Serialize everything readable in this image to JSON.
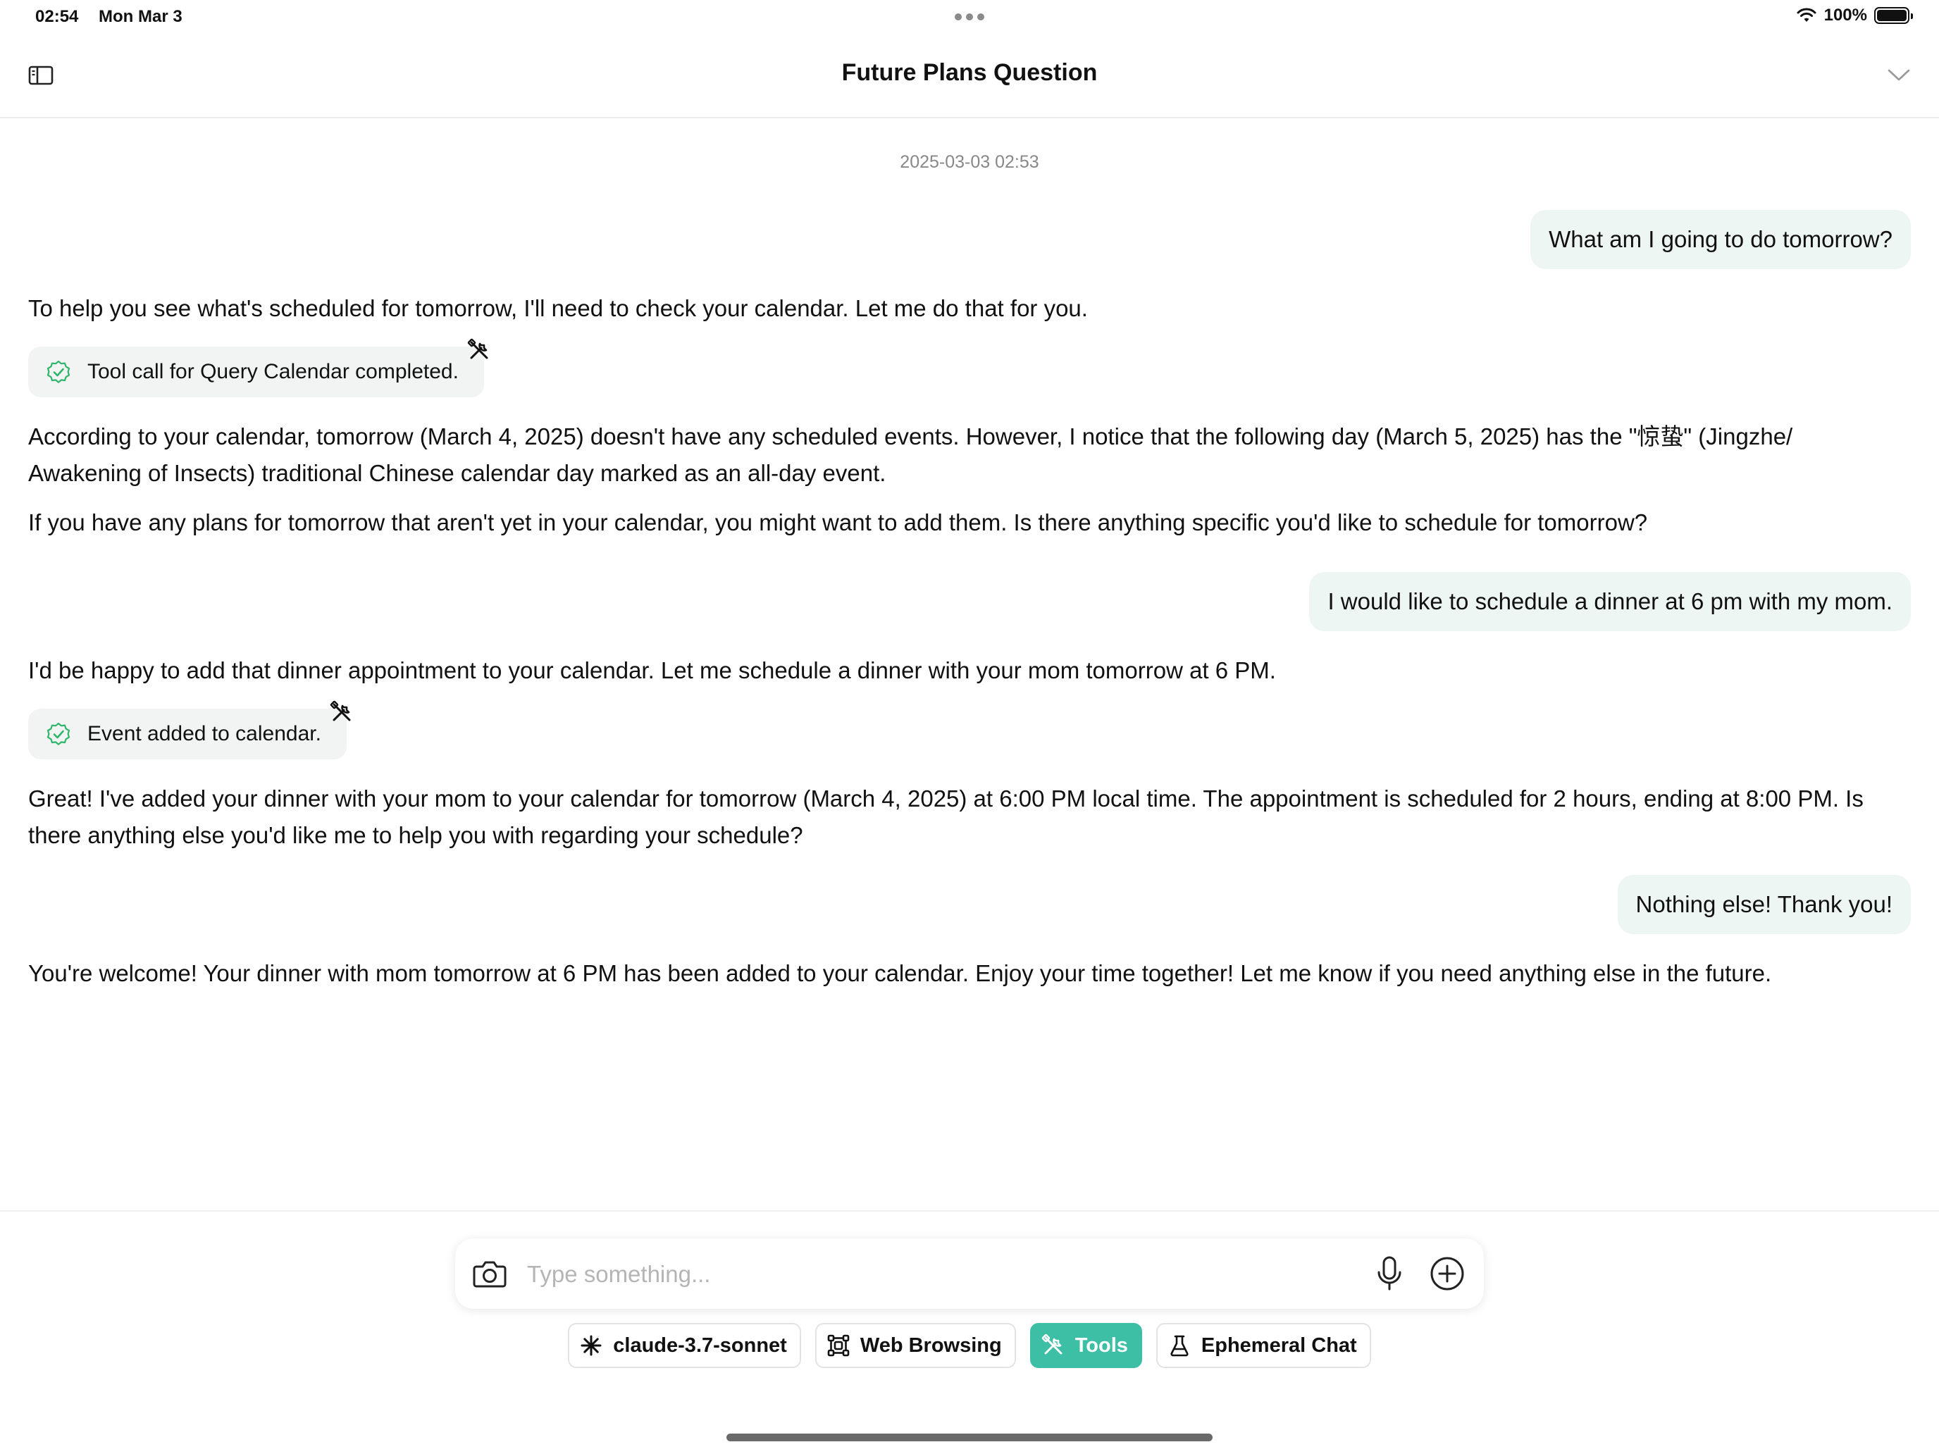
{
  "status_bar": {
    "time": "02:54",
    "date": "Mon Mar 3",
    "battery": "100%"
  },
  "header": {
    "title": "Future Plans Question"
  },
  "chat": {
    "timestamp": "2025-03-03 02:53",
    "messages": [
      {
        "role": "user",
        "text": "What am I going to do tomorrow?"
      },
      {
        "role": "assistant",
        "text": "To help you see what's scheduled for tomorrow, I'll need to check your calendar. Let me do that for you."
      },
      {
        "role": "tool",
        "text": "Tool call for Query Calendar completed."
      },
      {
        "role": "assistant",
        "text": "According to your calendar, tomorrow (March 4, 2025) doesn't have any scheduled events. However, I notice that the following day (March 5, 2025) has the \"惊蛰\" (Jingzhe/ Awakening of Insects) traditional Chinese calendar day marked as an all-day event."
      },
      {
        "role": "assistant",
        "text": "If you have any plans for tomorrow that aren't yet in your calendar, you might want to add them. Is there anything specific you'd like to schedule for tomorrow?"
      },
      {
        "role": "user",
        "text": "I would like to schedule a dinner at 6 pm with my mom."
      },
      {
        "role": "assistant",
        "text": "I'd be happy to add that dinner appointment to your calendar. Let me schedule a dinner with your mom tomorrow at 6 PM."
      },
      {
        "role": "tool",
        "text": "Event added to calendar."
      },
      {
        "role": "assistant",
        "text": "Great! I've added your dinner with your mom to your calendar for tomorrow (March 4, 2025) at 6:00 PM local time. The appointment is scheduled for 2 hours, ending at 8:00 PM. Is there anything else you'd like me to help you with regarding your schedule?"
      },
      {
        "role": "user",
        "text": "Nothing else! Thank you!"
      },
      {
        "role": "assistant",
        "text": "You're welcome! Your dinner with mom tomorrow at 6 PM has been added to your calendar. Enjoy your time together! Let me know if you need anything else in the future."
      }
    ]
  },
  "composer": {
    "placeholder": "Type something...",
    "value": ""
  },
  "chips": [
    {
      "label": "claude-3.7-sonnet",
      "icon": "sparkle-icon",
      "active": false
    },
    {
      "label": "Web Browsing",
      "icon": "globe-network-icon",
      "active": false
    },
    {
      "label": "Tools",
      "icon": "tools-icon",
      "active": true
    },
    {
      "label": "Ephemeral Chat",
      "icon": "flask-icon",
      "active": false
    }
  ],
  "colors": {
    "accent": "#3dbfa6",
    "user_bubble": "#eef6f3",
    "tool_pill": "#f1f4f2",
    "check_green": "#2fb56a"
  }
}
